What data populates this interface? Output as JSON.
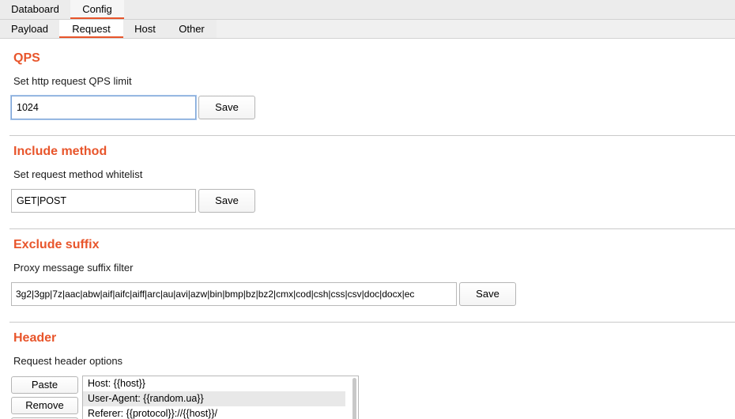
{
  "top_tabs": [
    {
      "label": "Databoard",
      "active": false
    },
    {
      "label": "Config",
      "active": true
    }
  ],
  "sub_tabs": [
    {
      "label": "Payload",
      "active": false
    },
    {
      "label": "Request",
      "active": true
    },
    {
      "label": "Host",
      "active": false
    },
    {
      "label": "Other",
      "active": false
    }
  ],
  "qps": {
    "title": "QPS",
    "description": "Set http request QPS limit",
    "value": "1024",
    "save_label": "Save"
  },
  "include_method": {
    "title": "Include method",
    "description": "Set request method whitelist",
    "value": "GET|POST",
    "save_label": "Save"
  },
  "exclude_suffix": {
    "title": "Exclude suffix",
    "description": "Proxy message suffix filter",
    "value": "3g2|3gp|7z|aac|abw|aif|aifc|aiff|arc|au|avi|azw|bin|bmp|bz|bz2|cmx|cod|csh|css|csv|doc|docx|ec",
    "save_label": "Save"
  },
  "header": {
    "title": "Header",
    "description": "Request header options",
    "paste_label": "Paste",
    "remove_label": "Remove",
    "items": [
      "Host: {{host}}",
      "User-Agent: {{random.ua}}",
      "Referer: {{protocol}}://{{host}}/"
    ],
    "selected_index": 1
  },
  "colors": {
    "accent": "#e8552b",
    "selection": "#e8e8e8",
    "focus_border": "#7fa6d8"
  }
}
